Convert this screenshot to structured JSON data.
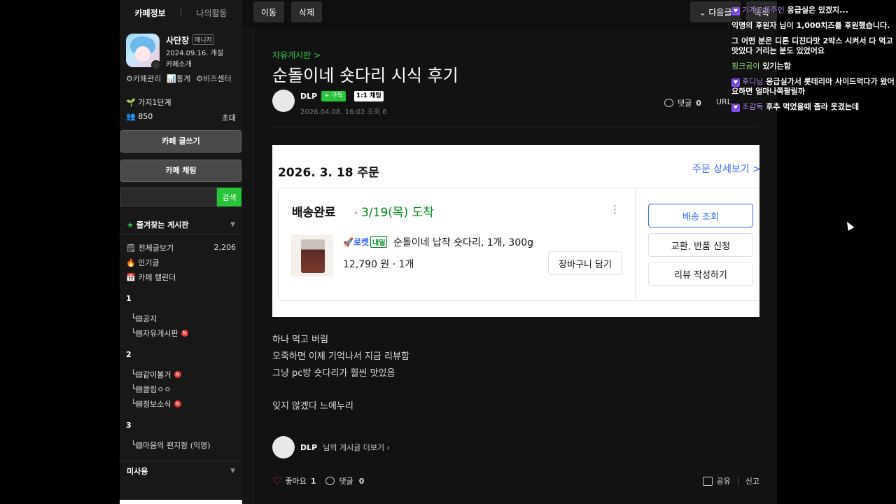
{
  "sidebar": {
    "tabs": [
      "카페정보",
      "나의활동"
    ],
    "cafe": {
      "name": "사단장",
      "badge": "매니저",
      "date": "2024.09.16. 개설",
      "intro": "카페소개"
    },
    "admin_links": [
      "⚙카페관리",
      "📊통계",
      "⚙비즈센터"
    ],
    "level": "가지1단계",
    "member_count": "850",
    "invite": "초대",
    "write_btn": "카페 글쓰기",
    "chat_btn": "카페 채팅",
    "search_placeholder": "",
    "search_btn": "검색",
    "favorites": "즐겨찾는 게시판",
    "menu": [
      {
        "label": "전체글보기",
        "count": "2,206"
      },
      {
        "label": "인기글",
        "count": ""
      },
      {
        "label": "카페 캘린더",
        "count": ""
      }
    ],
    "group1": "1",
    "group1_items": [
      "공지",
      "자유게시판"
    ],
    "group2": "2",
    "group2_items": [
      "같이볼거",
      "클립ㅇㅇ",
      "정보소식"
    ],
    "group3": "3",
    "group3_items": [
      "마음의 편지함 (익명)"
    ],
    "unused": "미사용",
    "new_badge": "N"
  },
  "topbar": {
    "move": "이동",
    "delete": "삭제",
    "next": "다음글",
    "list": "목록"
  },
  "article": {
    "board": "자유게시판 >",
    "title": "순돌이네 숏다리 시식 후기",
    "writer": "DLP",
    "subscribe": "+ 구독",
    "chat": "1:1 채팅",
    "date": "2026.04.08. 16:02",
    "views": "조회 6",
    "comment_label": "댓글",
    "comment_count": "0",
    "url": "URL",
    "body": [
      "하나 먹고 버림",
      "오죽하면 이제 기억나서 지금 리뷰함",
      "그냥 pc방 숏다리가 훨씬 맛있음",
      "",
      "잊지 않겠다 느에누리"
    ],
    "more_writer": "DLP",
    "more_suffix": "님의 게시글 더보기 ›",
    "like_label": "좋아요",
    "like_count": "1",
    "footer_comment": "댓글",
    "footer_comment_count": "0",
    "share": "공유",
    "report": "신고"
  },
  "order": {
    "date": "2026. 3. 18 주문",
    "detail_link": "주문 상세보기 >",
    "status": "배송완료",
    "arrive": "3/19(목) 도착",
    "rocket": "🚀로켓",
    "tomorrow": "내일",
    "product": "순돌이네 납작 숏다리, 1개, 300g",
    "price": "12,790 원 · 1개",
    "cart": "장바구니 담기",
    "track": "배송 조회",
    "exchange": "교환, 반품 신청",
    "review": "리뷰 작성하기"
  },
  "chat": [
    {
      "nick": "기계교체주인",
      "text": "응급실은 있겠지..."
    },
    {
      "nick": "",
      "text": "익명의 후원자 님이 1,000치즈를 후원했습니다."
    },
    {
      "nick": "",
      "text": "그 어떤 분은 디톤 디진다맛 2박스 시켜서 다 먹고 맛있다 거리는 분도 있었어요"
    },
    {
      "nick": "핑크곰이",
      "text": "있기는함"
    },
    {
      "nick": "후디닝",
      "text": "응급실가서 롯데리아 사이드먹다가 왔어요하면 얼마나쪽팔릴까"
    },
    {
      "nick": "조감독",
      "text": "후추 먹었을때 좀라 웃겼는데"
    }
  ]
}
